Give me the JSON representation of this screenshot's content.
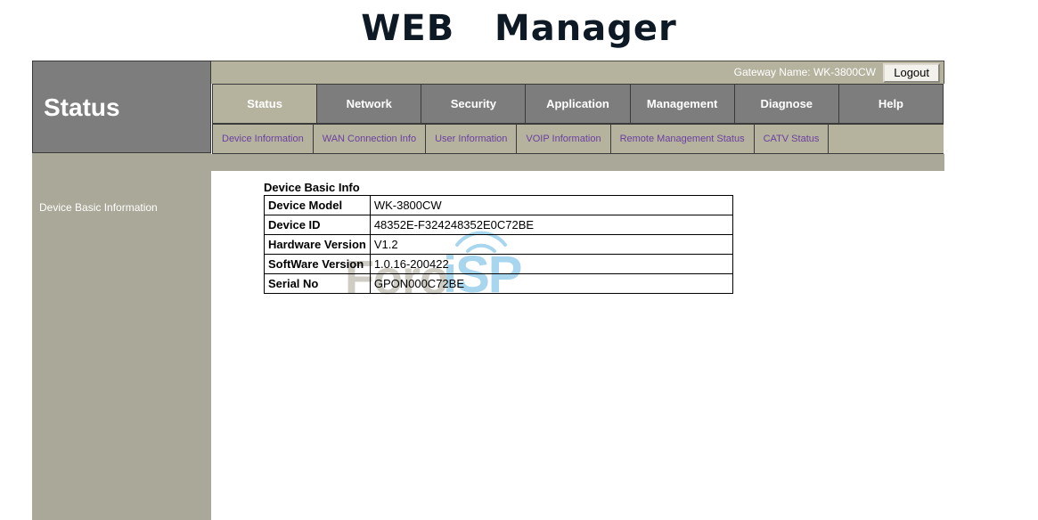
{
  "page": {
    "title": "WEB   Manager"
  },
  "sidebar": {
    "header_label": "Status",
    "link_label": "Device Basic Information"
  },
  "header": {
    "gateway_label": "Gateway Name: WK-3800CW",
    "logout_label": "Logout"
  },
  "main_tabs": [
    {
      "label": "Status",
      "active": true
    },
    {
      "label": "Network",
      "active": false
    },
    {
      "label": "Security",
      "active": false
    },
    {
      "label": "Application",
      "active": false
    },
    {
      "label": "Management",
      "active": false
    },
    {
      "label": "Diagnose",
      "active": false
    },
    {
      "label": "Help",
      "active": false
    }
  ],
  "sub_tabs": [
    {
      "label": "Device Information"
    },
    {
      "label": "WAN Connection Info"
    },
    {
      "label": "User Information"
    },
    {
      "label": "VOIP Information"
    },
    {
      "label": "Remote Management Status"
    },
    {
      "label": "CATV Status"
    }
  ],
  "content": {
    "table_caption": "Device Basic Info",
    "rows": [
      {
        "label": "Device Model",
        "value": "WK-3800CW"
      },
      {
        "label": "Device ID",
        "value": "48352E-F324248352E0C72BE"
      },
      {
        "label": "Hardware Version",
        "value": "V1.2"
      },
      {
        "label": "SoftWare Version",
        "value": "1.0.16-200422"
      },
      {
        "label": "Serial No",
        "value": "GPON000C72BE"
      }
    ]
  },
  "watermark": {
    "text": "Foro",
    "isp": "iSP"
  },
  "colors": {
    "tan": "#aaa898",
    "tan_light": "#b5b39e",
    "gray": "#7d7d7d",
    "sub_link": "#6b3fa0",
    "title": "#0d1a26",
    "watermark_blue": "#a8d6ef"
  }
}
